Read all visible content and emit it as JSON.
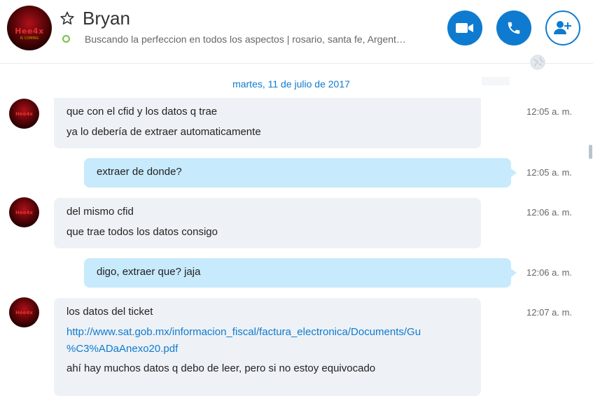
{
  "contact": {
    "name": "Bryan",
    "mood": "Buscando la perfeccion en todos los aspectos  |  rosario, santa fe, Argent…",
    "avatar_text": "Hee4x",
    "avatar_sub": "IS COMING"
  },
  "header_buttons": {
    "video_call": "video-call",
    "voice_call": "voice-call",
    "add_people": "add-people"
  },
  "conversation": {
    "date_divider": "martes, 11 de julio de 2017",
    "messages": [
      {
        "dir": "in",
        "lines": [
          "que con el cfid y los datos q trae",
          "ya lo debería de extraer automaticamente"
        ],
        "time": "12:05 a. m."
      },
      {
        "dir": "out",
        "lines": [
          "extraer de donde?"
        ],
        "time": "12:05 a. m."
      },
      {
        "dir": "in",
        "lines": [
          "del mismo cfid",
          "que trae todos los datos consigo"
        ],
        "time": "12:06 a. m."
      },
      {
        "dir": "out",
        "lines": [
          "digo, extraer que? jaja"
        ],
        "time": "12:06 a. m."
      },
      {
        "dir": "in",
        "lines": [
          "los datos del ticket",
          "http://www.sat.gob.mx/informacion_fiscal/factura_electronica/Documents/Gu",
          "%C3%ADaAnexo20.pdf",
          "ahí hay muchos datos q debo de leer, pero si no estoy equivocado"
        ],
        "time": "12:07 a. m."
      }
    ]
  },
  "colors": {
    "accent": "#0e7bd0",
    "incoming_bubble": "#eef1f5",
    "outgoing_bubble": "#c7eafc",
    "status_online": "#7ac143"
  }
}
